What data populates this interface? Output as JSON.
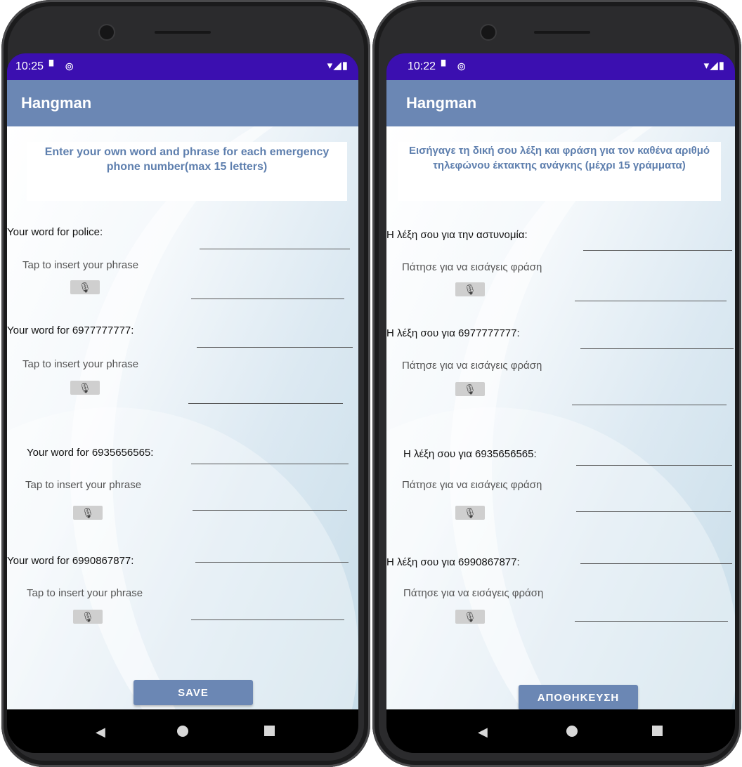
{
  "left": {
    "status": {
      "time": "10:25",
      "sd_icon": "▘",
      "sync_icon": "⊚",
      "right_icons": "▾◢▮"
    },
    "app_title": "Hangman",
    "instruction": "Enter your own word and phrase for each emergency phone number(max 15 letters)",
    "rows": [
      {
        "label": "Your word for police:",
        "phrase": "Tap to insert your phrase"
      },
      {
        "label": "Your word for 6977777777:",
        "phrase": "Tap to insert your phrase"
      },
      {
        "label": "Your word for 6935656565:",
        "phrase": "Tap to insert your phrase"
      },
      {
        "label": "Your word for 6990867877:",
        "phrase": "Tap to insert your phrase"
      }
    ],
    "save_label": "SAVE"
  },
  "right": {
    "status": {
      "time": "10:22",
      "sd_icon": "▘",
      "sync_icon": "⊚",
      "right_icons": "▾◢▮"
    },
    "app_title": "Hangman",
    "instruction": "Εισήγαγε τη δική σου λέξη και φράση για τον καθένα αριθμό τηλεφώνου έκτακτης ανάγκης (μέχρι 15 γράμματα)",
    "rows": [
      {
        "label": "Η λέξη σου για την αστυνομία:",
        "phrase": "Πάτησε για να εισάγεις φράση"
      },
      {
        "label": "Η λέξη σου για 6977777777:",
        "phrase": "Πάτησε για να εισάγεις φράση"
      },
      {
        "label": "Η λέξη σου για 6935656565:",
        "phrase": "Πάτησε για να εισάγεις φράση"
      },
      {
        "label": "Η λέξη σου για 6990867877:",
        "phrase": "Πάτησε για να εισάγεις φράση"
      }
    ],
    "save_label": "ΑΠΟΘΗΚΕΥΣΗ"
  },
  "icons": {
    "mic": "mic-icon",
    "back": "back-triangle-icon",
    "home": "home-circle-icon",
    "recent": "recent-square-icon"
  }
}
